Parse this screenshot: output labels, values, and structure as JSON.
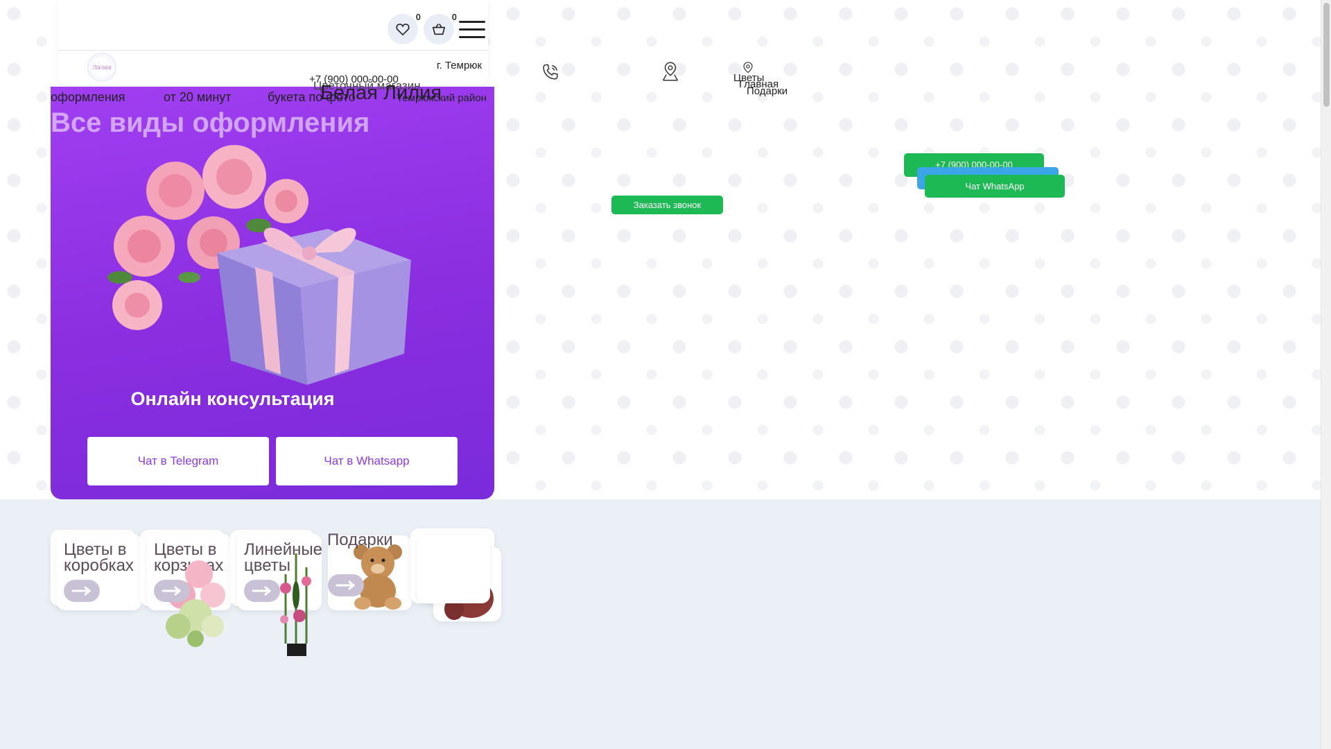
{
  "header": {
    "city": "г. Темрюк",
    "favorites_count": "0",
    "cart_count": "0",
    "phone": "+7 (900) 000-00-00",
    "shop_subtitle": "Цветочный магазин",
    "shop_name": "Белая Лилия",
    "region": "Темрюкский район",
    "logo_text": "Лилия"
  },
  "features": [
    {
      "label": "оформления"
    },
    {
      "label": "от 20 минут"
    },
    {
      "label": "букета по фото"
    },
    {
      "label": ""
    }
  ],
  "promo": {
    "title": "Все виды оформления",
    "subtitle": "Онлайн консультация",
    "telegram_label": "Чат в Telegram",
    "whatsapp_label": "Чат в Whatsapp"
  },
  "hero_menu": {
    "item1": "Цветы",
    "item2": "Главная",
    "item3": "Подарки"
  },
  "hero_buttons": {
    "callback_label": "Заказать звонок",
    "phone_label": "+7 (900) 000-00-00",
    "whatsapp_label": "Чат WhatsApp"
  },
  "categories": [
    {
      "title": "Цветы в коробках"
    },
    {
      "title": "Цветы в корзинах"
    },
    {
      "title": "Линейные цветы"
    },
    {
      "title": "Подарки"
    },
    {
      "title": ""
    }
  ],
  "colors": {
    "promo_purple": "#8a2ee0",
    "green": "#1db954",
    "blue": "#3aa6e8"
  }
}
